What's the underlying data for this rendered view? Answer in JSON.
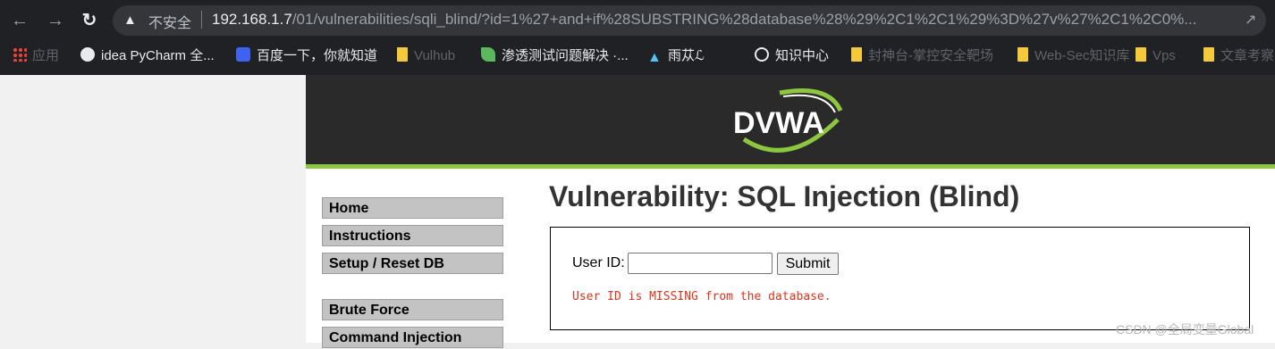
{
  "browser": {
    "security_label": "不安全",
    "url_host": "192.168.1.7",
    "url_path": "/01/vulnerabilities/sqli_blind/?id=1%27+and+if%28SUBSTRING%28database%28%29%2C1%2C1%29%3D%27v%27%2C1%2C0%...",
    "bookmarks": [
      "应用",
      "idea PyCharm 全...",
      "百度一下，你就知道",
      "Vulhub",
      "渗透测试问题解决 ·...",
      "雨苁ℒ",
      "知识中心",
      "封神台-掌控安全靶场",
      "Web-Sec知识库",
      "Vps",
      "文章考察"
    ]
  },
  "dvwa": {
    "logo_text": "DVWA",
    "title": "Vulnerability: SQL Injection (Blind)",
    "menu": [
      "Home",
      "Instructions",
      "Setup / Reset DB",
      "Brute Force",
      "Command Injection"
    ],
    "form": {
      "label": "User ID:",
      "input_value": "",
      "submit_label": "Submit",
      "message": "User ID is MISSING from the database."
    }
  },
  "watermark": "CSDN @全局变量Global",
  "colors": {
    "header": "#2a2a2a",
    "accent": "#8dc63f",
    "error": "#e4321b"
  }
}
